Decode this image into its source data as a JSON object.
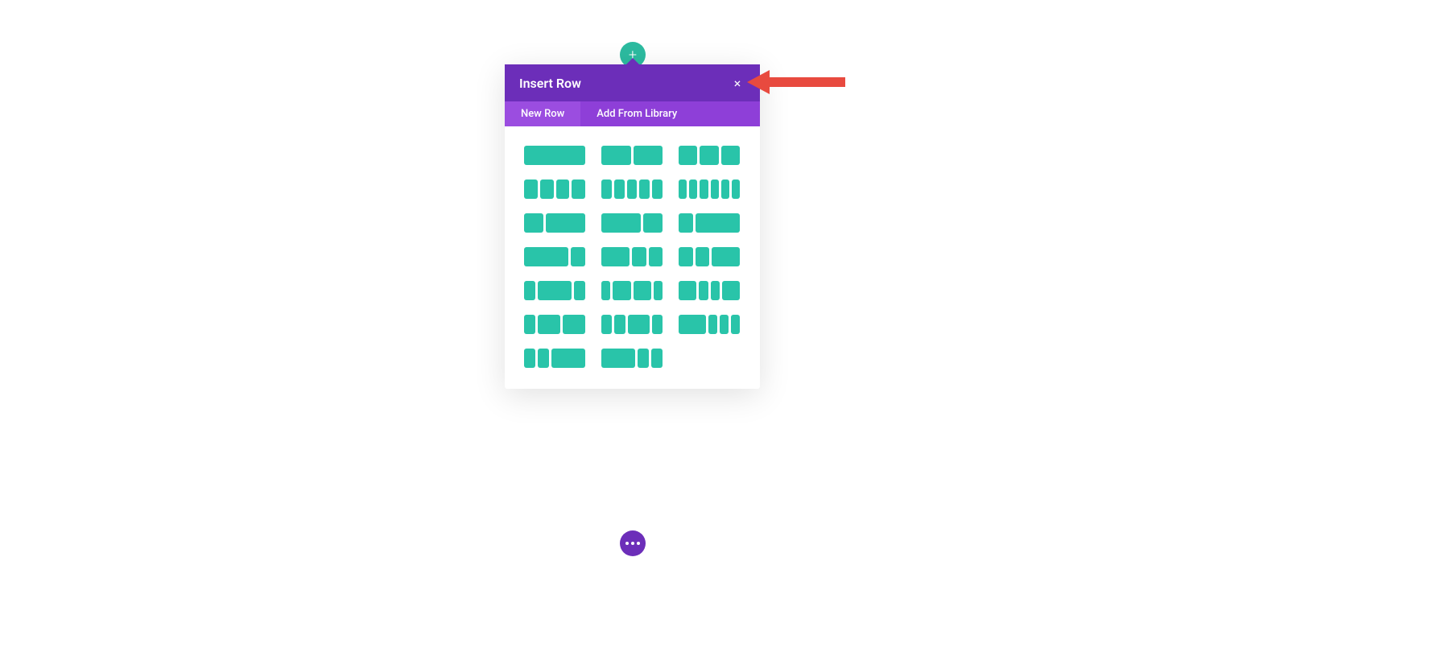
{
  "modal": {
    "title": "Insert Row",
    "close_label": "×"
  },
  "tabs": {
    "items": [
      {
        "label": "New Row",
        "active": true
      },
      {
        "label": "Add From Library",
        "active": false
      }
    ]
  },
  "layouts": [
    {
      "name": "one-column",
      "cols": [
        1
      ]
    },
    {
      "name": "two-columns",
      "cols": [
        1,
        1
      ]
    },
    {
      "name": "three-columns",
      "cols": [
        1,
        1,
        1
      ]
    },
    {
      "name": "four-columns",
      "cols": [
        1,
        1,
        1,
        1
      ]
    },
    {
      "name": "five-columns",
      "cols": [
        1,
        1,
        1,
        1,
        1
      ]
    },
    {
      "name": "six-columns",
      "cols": [
        1,
        1,
        1,
        1,
        1,
        1
      ]
    },
    {
      "name": "one-third-two-thirds",
      "cols": [
        1,
        2
      ]
    },
    {
      "name": "two-thirds-one-third",
      "cols": [
        2,
        1
      ]
    },
    {
      "name": "one-quarter-three-quarters",
      "cols": [
        1,
        3
      ]
    },
    {
      "name": "three-quarters-one-quarter",
      "cols": [
        3,
        1
      ]
    },
    {
      "name": "one-half-one-quarter-one-quarter",
      "cols": [
        2,
        1,
        1
      ]
    },
    {
      "name": "one-quarter-one-quarter-one-half",
      "cols": [
        1,
        1,
        2
      ]
    },
    {
      "name": "narrow-wide-narrow",
      "cols": [
        1,
        3,
        1
      ]
    },
    {
      "name": "narrow-wide-wide-narrow",
      "cols": [
        1,
        2,
        2,
        1
      ]
    },
    {
      "name": "wide-narrow-narrow-wide",
      "cols": [
        2,
        1,
        1,
        2
      ]
    },
    {
      "name": "narrow-wide-wide",
      "cols": [
        1,
        2,
        2
      ]
    },
    {
      "name": "narrow-narrow-wide-narrow",
      "cols": [
        1,
        1,
        2,
        1
      ]
    },
    {
      "name": "wide-narrow-narrow-narrow",
      "cols": [
        3,
        1,
        1,
        1
      ]
    },
    {
      "name": "narrow-narrow-wide",
      "cols": [
        1,
        1,
        3
      ]
    },
    {
      "name": "wide-narrow-narrow",
      "cols": [
        3,
        1,
        1
      ]
    }
  ],
  "buttons": {
    "add_section": "+",
    "more": "..."
  },
  "colors": {
    "primary": "#6c2eb9",
    "tab_bg": "#8e3fd8",
    "tab_active": "#9b4de0",
    "accent": "#29c4a9",
    "add_bg": "#2cbba0"
  },
  "annotation": {
    "arrow_color": "#e84a3f"
  }
}
